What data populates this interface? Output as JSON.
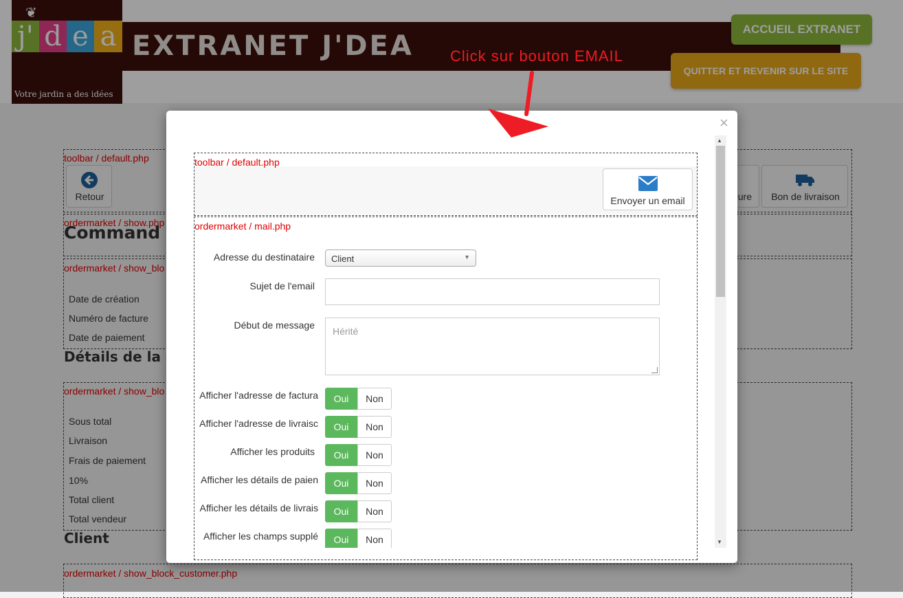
{
  "header": {
    "app_title": "EXTRANET J'DEA",
    "logo_letters": [
      "j'",
      "d",
      "e",
      "a"
    ],
    "logo_letter_colors": [
      "#8fb83c",
      "#e63f8a",
      "#3aa7dd",
      "#f2b21b"
    ],
    "logo_tagline": "Votre jardin a des idées",
    "btn_accueil": "ACCUEIL EXTRANET",
    "btn_quitter": "QUITTER ET REVENIR SUR LE SITE",
    "annotation": "Click sur bouton EMAIL"
  },
  "background": {
    "toolbar_tpl": "toolbar / default.php",
    "btn_retour": "Retour",
    "btn_facture_partial": "ure",
    "btn_bon_livraison": "Bon de livraison",
    "show_tpl": "ordermarket / show.php",
    "heading_commande": "Command",
    "show_block_tpl_1": "ordermarket / show_blo",
    "info_rows": [
      "Date de création",
      "Numéro de facture",
      "Date de paiement"
    ],
    "heading_details": "Détails de la c",
    "show_block_tpl_2": "ordermarket / show_blo",
    "totals_rows": [
      "Sous total",
      "Livraison",
      "Frais de paiement",
      "10%",
      "Total client",
      "Total vendeur"
    ],
    "heading_client": "Client",
    "customer_tpl": "ordermarket / show_block_customer.php"
  },
  "modal": {
    "close": "×",
    "toolbar_tpl": "toolbar / default.php",
    "email_button": "Envoyer un email",
    "mail_tpl": "ordermarket / mail.php",
    "fields": {
      "recipient_label": "Adresse du destinataire",
      "recipient_value": "Client",
      "subject_label": "Sujet de l'email",
      "subject_value": "",
      "message_label": "Début de message",
      "message_placeholder": "Hérité"
    },
    "toggles": [
      {
        "label": "Afficher l'adresse de factura",
        "on": "Oui",
        "off": "Non"
      },
      {
        "label": "Afficher l'adresse de livraisc",
        "on": "Oui",
        "off": "Non"
      },
      {
        "label": "Afficher les produits",
        "on": "Oui",
        "off": "Non"
      },
      {
        "label": "Afficher les détails de paien",
        "on": "Oui",
        "off": "Non"
      },
      {
        "label": "Afficher les détails de livrais",
        "on": "Oui",
        "off": "Non"
      },
      {
        "label": "Afficher les champs supplé",
        "on": "Oui",
        "off": "Non"
      }
    ]
  },
  "colors": {
    "brand_dark": "#3a0f0a",
    "accent_green": "#8fb83c",
    "accent_orange": "#e8a81a",
    "toggle_on": "#5cb85c",
    "template_label_red": "#e00000",
    "annotation_red": "#ee1c24",
    "email_icon_blue": "#2c7dc8"
  }
}
